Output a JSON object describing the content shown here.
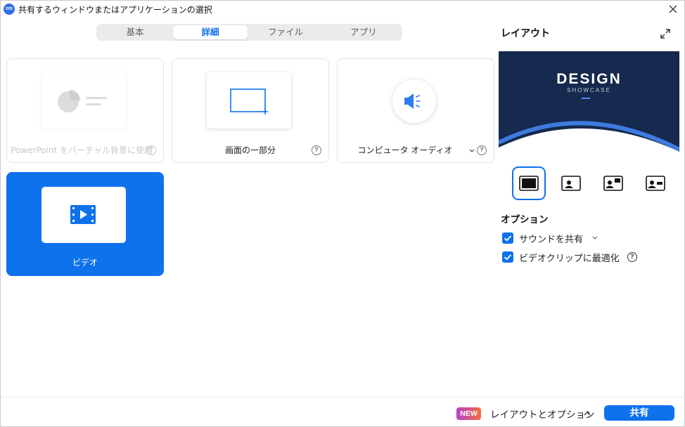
{
  "window": {
    "app_icon_text": "zm",
    "title": "共有するウィンドウまたはアプリケーションの選択"
  },
  "tabs": [
    {
      "label": "基本",
      "active": false
    },
    {
      "label": "詳細",
      "active": true
    },
    {
      "label": "ファイル",
      "active": false
    },
    {
      "label": "アプリ",
      "active": false
    }
  ],
  "share_options": [
    {
      "label": "PowerPoint をバーチャル背景に使用",
      "state": "disabled",
      "icon": "pie-chart-icon"
    },
    {
      "label": "画面の一部分",
      "state": "normal",
      "icon": "screen-portion-icon"
    },
    {
      "label": "コンピュータ オーディオ",
      "state": "normal",
      "icon": "speaker-icon",
      "has_dropdown": true
    },
    {
      "label": "ビデオ",
      "state": "selected",
      "icon": "video-file-icon"
    }
  ],
  "right_panel": {
    "layout_title": "レイアウト",
    "preview": {
      "logo": "DESIGN",
      "subtitle": "SHOWCASE"
    },
    "layouts": [
      "content-only",
      "speaker-left",
      "speaker-top-right",
      "speaker-right"
    ],
    "options_title": "オプション",
    "options": [
      {
        "label": "サウンドを共有",
        "checked": true,
        "has_dropdown": true
      },
      {
        "label": "ビデオクリップに最適化",
        "checked": true,
        "has_help": true
      }
    ]
  },
  "footer": {
    "badge": "NEW",
    "layout_options_label": "レイアウトとオプション",
    "share_label": "共有"
  },
  "colors": {
    "accent": "#0e72ed",
    "preview_bg": "#16294e",
    "badge_gradient_start": "#b541c9",
    "badge_gradient_end": "#f36e3c"
  }
}
